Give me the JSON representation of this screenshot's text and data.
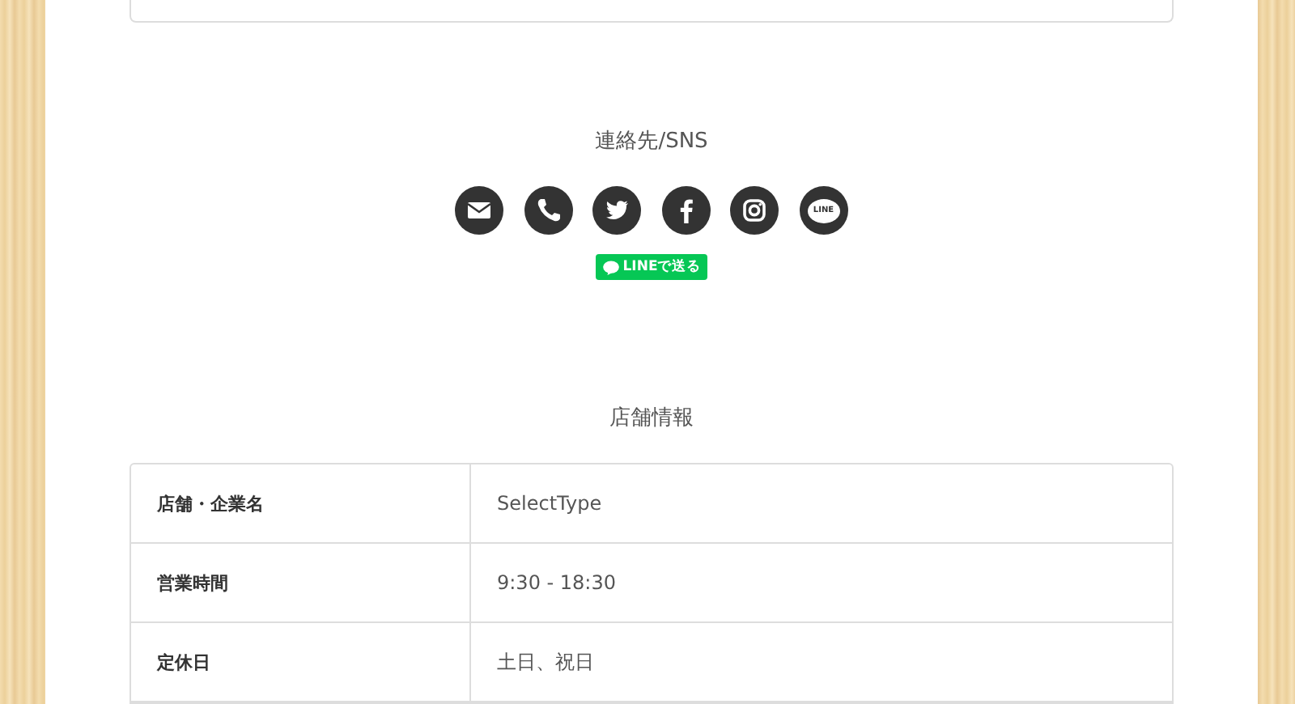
{
  "contact": {
    "title": "連絡先/SNS",
    "icons": [
      {
        "kind": "mail"
      },
      {
        "kind": "phone"
      },
      {
        "kind": "twitter"
      },
      {
        "kind": "facebook"
      },
      {
        "kind": "instagram"
      },
      {
        "kind": "line",
        "text": "LINE"
      }
    ],
    "share_button": "LINEで送る"
  },
  "shop_info": {
    "title": "店舗情報",
    "rows": [
      {
        "label": "店舗・企業名",
        "value": "SelectType"
      },
      {
        "label": "営業時間",
        "value": "9:30 - 18:30"
      },
      {
        "label": "定休日",
        "value": "土日、祝日"
      }
    ]
  }
}
